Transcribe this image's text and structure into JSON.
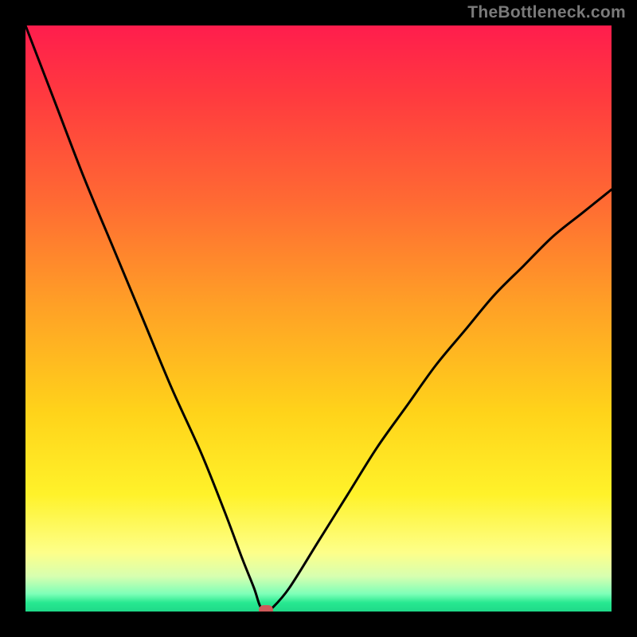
{
  "watermark": "TheBottleneck.com",
  "chart_data": {
    "type": "line",
    "title": "",
    "xlabel": "",
    "ylabel": "",
    "xlim": [
      0,
      100
    ],
    "ylim": [
      0,
      100
    ],
    "grid": false,
    "legend": false,
    "series": [
      {
        "name": "curve",
        "x": [
          0,
          5,
          10,
          15,
          20,
          25,
          30,
          34,
          37,
          39,
          40,
          41,
          42,
          45,
          50,
          55,
          60,
          65,
          70,
          75,
          80,
          85,
          90,
          95,
          100
        ],
        "y": [
          100,
          87,
          74,
          62,
          50,
          38,
          27,
          17,
          9,
          4,
          1,
          0,
          0.5,
          4,
          12,
          20,
          28,
          35,
          42,
          48,
          54,
          59,
          64,
          68,
          72
        ]
      }
    ],
    "gradient_scale": {
      "axis": "y",
      "stops": [
        {
          "pos": 0,
          "color": "#27e890"
        },
        {
          "pos": 2,
          "color": "#7dffb8"
        },
        {
          "pos": 6,
          "color": "#d7ffb0"
        },
        {
          "pos": 12,
          "color": "#fdff8a"
        },
        {
          "pos": 22,
          "color": "#fff22a"
        },
        {
          "pos": 38,
          "color": "#ffd31a"
        },
        {
          "pos": 55,
          "color": "#ffa126"
        },
        {
          "pos": 72,
          "color": "#ff6a33"
        },
        {
          "pos": 88,
          "color": "#ff3a3f"
        },
        {
          "pos": 100,
          "color": "#ff1d4d"
        }
      ]
    },
    "marker": {
      "x": 41,
      "y": 0,
      "color": "#cf5a5a"
    },
    "annotations": []
  },
  "colors": {
    "background": "#000000",
    "curve_stroke": "#000000",
    "marker": "#cf5a5a",
    "watermark": "#7a7a7a"
  }
}
